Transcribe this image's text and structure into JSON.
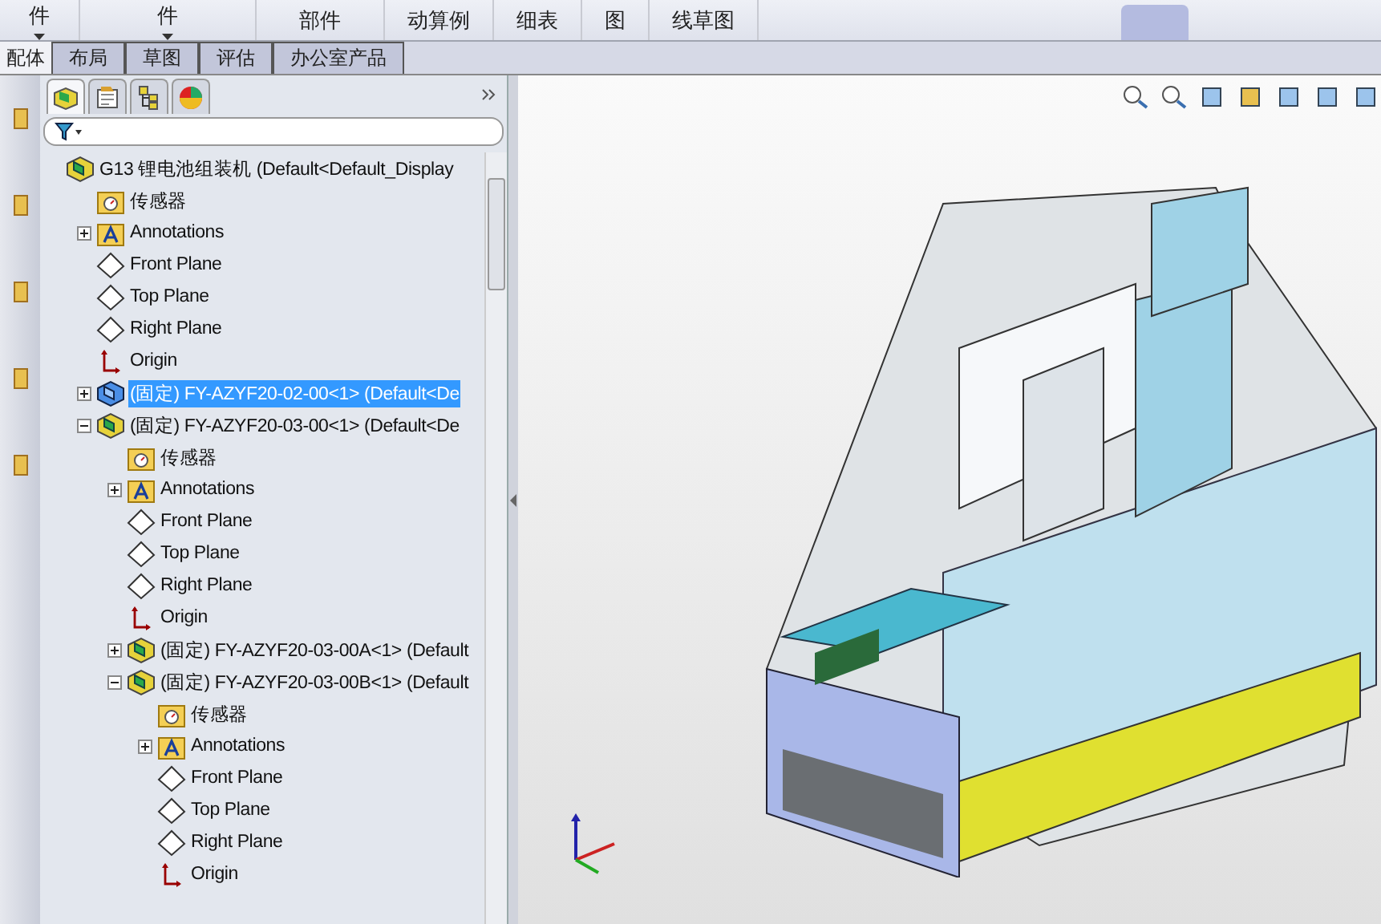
{
  "toolbar": {
    "buttons": [
      {
        "label": "件",
        "menu": true
      },
      {
        "label": "件",
        "menu": true
      },
      {
        "label": "部件",
        "menu": false
      },
      {
        "label": "动算例",
        "menu": false
      },
      {
        "label": "细表",
        "menu": false
      },
      {
        "label": "图",
        "menu": false
      },
      {
        "label": "线草图",
        "menu": false
      }
    ]
  },
  "tabs": [
    {
      "label": "配体",
      "selected": true
    },
    {
      "label": "布局",
      "selected": false
    },
    {
      "label": "草图",
      "selected": false
    },
    {
      "label": "评估",
      "selected": false
    },
    {
      "label": "办公室产品",
      "selected": false
    }
  ],
  "panel_tabs": [
    {
      "selected": true
    },
    {
      "selected": false
    },
    {
      "selected": false
    },
    {
      "selected": false
    }
  ],
  "tree": {
    "kind": "assembly",
    "label": "G13 锂电池组装机  (Default<Default_Display",
    "selected": false,
    "children": [
      {
        "kind": "sensor",
        "label": "传感器",
        "selected": false
      },
      {
        "kind": "annotations",
        "label": "Annotations",
        "selected": false,
        "expanded": false
      },
      {
        "kind": "plane",
        "label": "Front Plane",
        "selected": false
      },
      {
        "kind": "plane",
        "label": "Top Plane",
        "selected": false
      },
      {
        "kind": "plane",
        "label": "Right Plane",
        "selected": false
      },
      {
        "kind": "origin",
        "label": "Origin",
        "selected": false
      },
      {
        "kind": "part",
        "label": "(固定) FY-AZYF20-02-00<1> (Default<De",
        "selected": true,
        "expanded": false
      },
      {
        "kind": "assembly",
        "label": "(固定) FY-AZYF20-03-00<1> (Default<De",
        "selected": false,
        "expanded": true,
        "children": [
          {
            "kind": "sensor",
            "label": "传感器",
            "selected": false
          },
          {
            "kind": "annotations",
            "label": "Annotations",
            "selected": false,
            "expanded": false
          },
          {
            "kind": "plane",
            "label": "Front Plane",
            "selected": false
          },
          {
            "kind": "plane",
            "label": "Top Plane",
            "selected": false
          },
          {
            "kind": "plane",
            "label": "Right Plane",
            "selected": false
          },
          {
            "kind": "origin",
            "label": "Origin",
            "selected": false
          },
          {
            "kind": "assembly",
            "label": "(固定) FY-AZYF20-03-00A<1> (Default",
            "selected": false,
            "expanded": false
          },
          {
            "kind": "assembly",
            "label": "(固定) FY-AZYF20-03-00B<1> (Default",
            "selected": false,
            "expanded": true,
            "children": [
              {
                "kind": "sensor",
                "label": "传感器",
                "selected": false
              },
              {
                "kind": "annotations",
                "label": "Annotations",
                "selected": false,
                "expanded": false
              },
              {
                "kind": "plane",
                "label": "Front Plane",
                "selected": false
              },
              {
                "kind": "plane",
                "label": "Top Plane",
                "selected": false
              },
              {
                "kind": "plane",
                "label": "Right Plane",
                "selected": false
              },
              {
                "kind": "origin",
                "label": "Origin",
                "selected": false
              }
            ]
          }
        ]
      }
    ]
  }
}
